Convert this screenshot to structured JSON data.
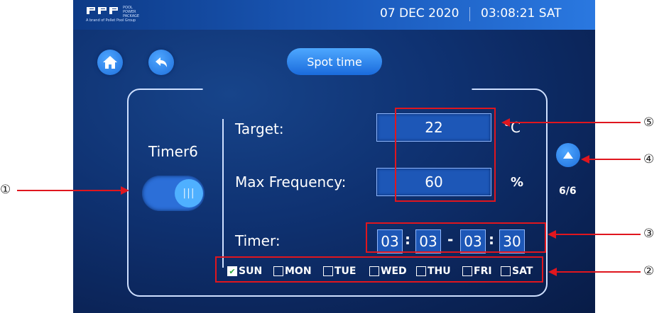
{
  "status": {
    "date": "07 DEC 2020",
    "time": "03:08:21",
    "weekday": "SAT"
  },
  "logo": {
    "line1": "POOL",
    "line2": "POWER",
    "line3": "PACKAGE",
    "tagline": "A brand of Pollet Pool Group"
  },
  "header": {
    "title_button": "Spot time"
  },
  "timer": {
    "name": "Timer6",
    "enabled": true
  },
  "target": {
    "label": "Target:",
    "value": "22",
    "unit": "°C"
  },
  "max_frequency": {
    "label": "Max Frequency:",
    "value": "60",
    "unit": "%"
  },
  "schedule": {
    "label": "Timer:",
    "start_h": "03",
    "start_m": "03",
    "dash": "-",
    "end_h": "03",
    "end_m": "30",
    "colon": ":"
  },
  "days": [
    {
      "label": "SUN",
      "checked": true
    },
    {
      "label": "MON",
      "checked": false
    },
    {
      "label": "TUE",
      "checked": false
    },
    {
      "label": "WED",
      "checked": false
    },
    {
      "label": "THU",
      "checked": false
    },
    {
      "label": "FRI",
      "checked": false
    },
    {
      "label": "SAT",
      "checked": false
    }
  ],
  "pager": {
    "text": "6/6"
  },
  "callouts": {
    "c1": "①",
    "c2": "②",
    "c3": "③",
    "c4": "④",
    "c5": "⑤"
  },
  "colors": {
    "accent": "#1e6fdc",
    "annotation": "#e0161e",
    "screen_bg": "#0f3272"
  }
}
